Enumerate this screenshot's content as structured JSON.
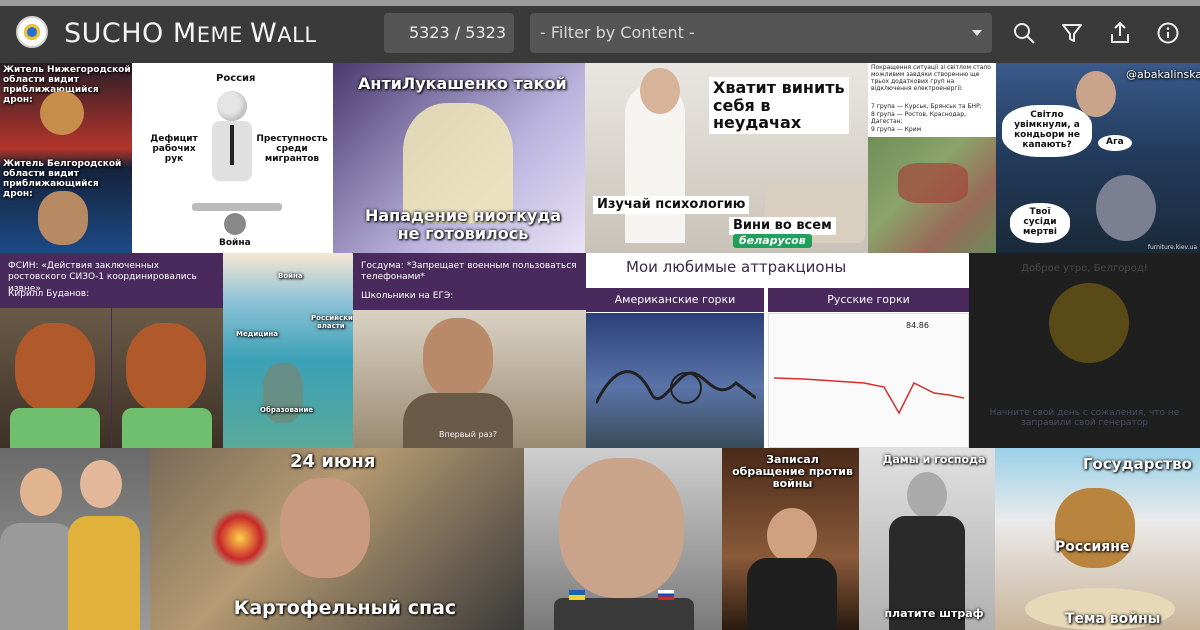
{
  "header": {
    "title_parts": [
      "S",
      "UCHO ",
      "M",
      "EME ",
      "W",
      "ALL"
    ],
    "counter": "5323 / 5323",
    "filter_placeholder": "- Filter by Content -",
    "icons": [
      "search-icon",
      "filter-icon",
      "share-icon",
      "info-icon"
    ]
  },
  "tiles": {
    "t1": {
      "top": "Житель Нижегородской области видит приближающийся дрон:",
      "bottom": "Житель Белгородской области видит приближающийся дрон:"
    },
    "t2": {
      "top": "Россия",
      "left": "Дефицит рабочих рук",
      "right": "Преступность среди мигрантов",
      "bottom": "Война"
    },
    "t3": {
      "top": "АнтиЛукашенко такой",
      "bottom": "Нападение ниоткуда не готовилось"
    },
    "t4": {
      "top": "Хватит винить себя в неудачах",
      "mid": "Изучай психологию",
      "right": "Вини во всем",
      "badge": "беларусов"
    },
    "t5": {
      "text": "Покращення ситуації зі світлом стало можливим завдяки створенню ще трьох додаткових груп на відключення електроенергії:",
      "g7": "7 група — Курськ, Брянськ та БНР;",
      "g8": "8 група — Ростов, Краснодар, Дагестан;",
      "g9": "9 група — Крим"
    },
    "t6": {
      "handle": "@abakalinska",
      "b1": "Світло увімкнули, а кондьори не капають?",
      "b2": "Ага",
      "b3": "Твої сусіди мертві",
      "credit": "furniture.kiev.ua"
    },
    "t7": {
      "top": "ФСИН: «Действия заключенных ростовского СИЗО-1 координировались извне»",
      "sub": "Кирилл Буданов:"
    },
    "t8": {
      "l1": "Война",
      "l2": "Российские власти",
      "l3": "Медицина",
      "l4": "Образование"
    },
    "t9": {
      "top": "Госдума: *Запрещает военным пользоваться телефонами*",
      "sub": "Школьники на ЕГЭ:",
      "bottom": "Впервый раз?"
    },
    "t10": {
      "title": "Мои любимые аттракционы",
      "left": "Американские горки",
      "right": "Русские горки",
      "price": "84.86"
    },
    "t11": {
      "top": "Доброе утро, Белгород!",
      "bottom": "Начните свой день с сожаления, что не заправили свой генератор"
    },
    "t13": {
      "top": "24 июня",
      "bottom": "Картофельный спас"
    },
    "t15": {
      "top": "Записал обращение против войны"
    },
    "t16": {
      "top": "Дамы и господа",
      "bottom": "платите штраф"
    },
    "t17": {
      "top": "Государство",
      "mid": "Россияне",
      "bottom": "Тема войны"
    }
  },
  "colors": {
    "header": "#3a3a3a",
    "field": "#555555",
    "purple": "#4a2a5c"
  }
}
